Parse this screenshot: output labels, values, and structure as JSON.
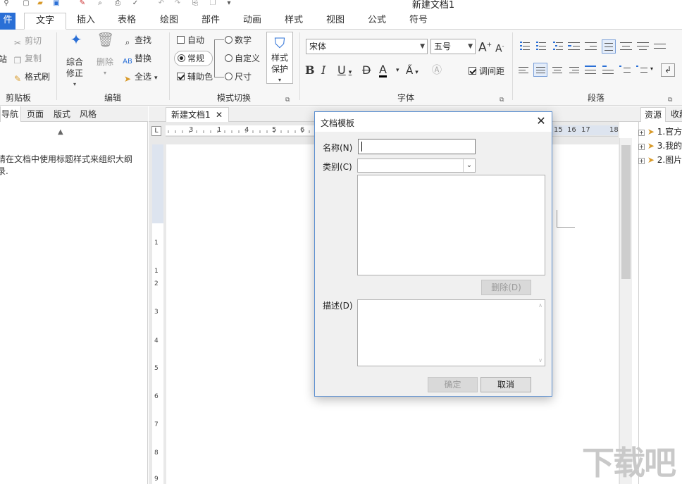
{
  "window": {
    "title": "新建文档1"
  },
  "ribbon_tabs": [
    "件",
    "文字",
    "插入",
    "表格",
    "绘图",
    "部件",
    "动画",
    "样式",
    "视图",
    "公式",
    "符号"
  ],
  "active_tab": "文字",
  "clipboard": {
    "paste": "站",
    "cut": "剪切",
    "copy": "复制",
    "format_painter": "格式刷",
    "label": "剪贴板"
  },
  "edit": {
    "revise_line1": "综合",
    "revise_line2": "修正",
    "delete": "删除",
    "find": "查找",
    "replace": "替换",
    "select_all": "全选",
    "label": "编辑"
  },
  "mode": {
    "auto": "自动",
    "normal": "常规",
    "aux_color": "辅助色",
    "number": "数学",
    "custom": "自定义",
    "size": "尺寸",
    "style_protect_line1": "样式",
    "style_protect_line2": "保护",
    "label": "模式切换"
  },
  "font": {
    "name": "宋体",
    "size": "五号",
    "spacing": "调间距",
    "label": "字体"
  },
  "paragraph": {
    "label": "段落"
  },
  "left_panel": {
    "tabs": [
      "导航",
      "页面",
      "版式",
      "风格"
    ],
    "hint_line1": "请在文档中使用标题样式来组织大纲",
    "hint_line2": "录."
  },
  "doc_tab": {
    "name": "新建文档1"
  },
  "ruler_numbers": [
    "3",
    "1",
    "4",
    "5",
    "6",
    "7",
    "15",
    "16",
    "17",
    "18"
  ],
  "vruler_numbers": [
    "1",
    "1",
    "2",
    "3",
    "4",
    "5",
    "6",
    "7",
    "8",
    "9"
  ],
  "right_panel": {
    "tabs": [
      "资源",
      "收藏"
    ],
    "items": [
      "1.官方",
      "3.我的",
      "2.图片"
    ]
  },
  "dialog": {
    "title": "文档模板",
    "name_label": "名称(N)",
    "category_label": "类别(C)",
    "delete_button": "删除(D)",
    "desc_label": "描述(D)",
    "ok_button": "确定",
    "cancel_button": "取消",
    "name_value": "",
    "category_value": ""
  },
  "watermark": "下载吧",
  "colors": {
    "accent": "#2a6fd6",
    "dialog_border": "#5b8fd1"
  }
}
